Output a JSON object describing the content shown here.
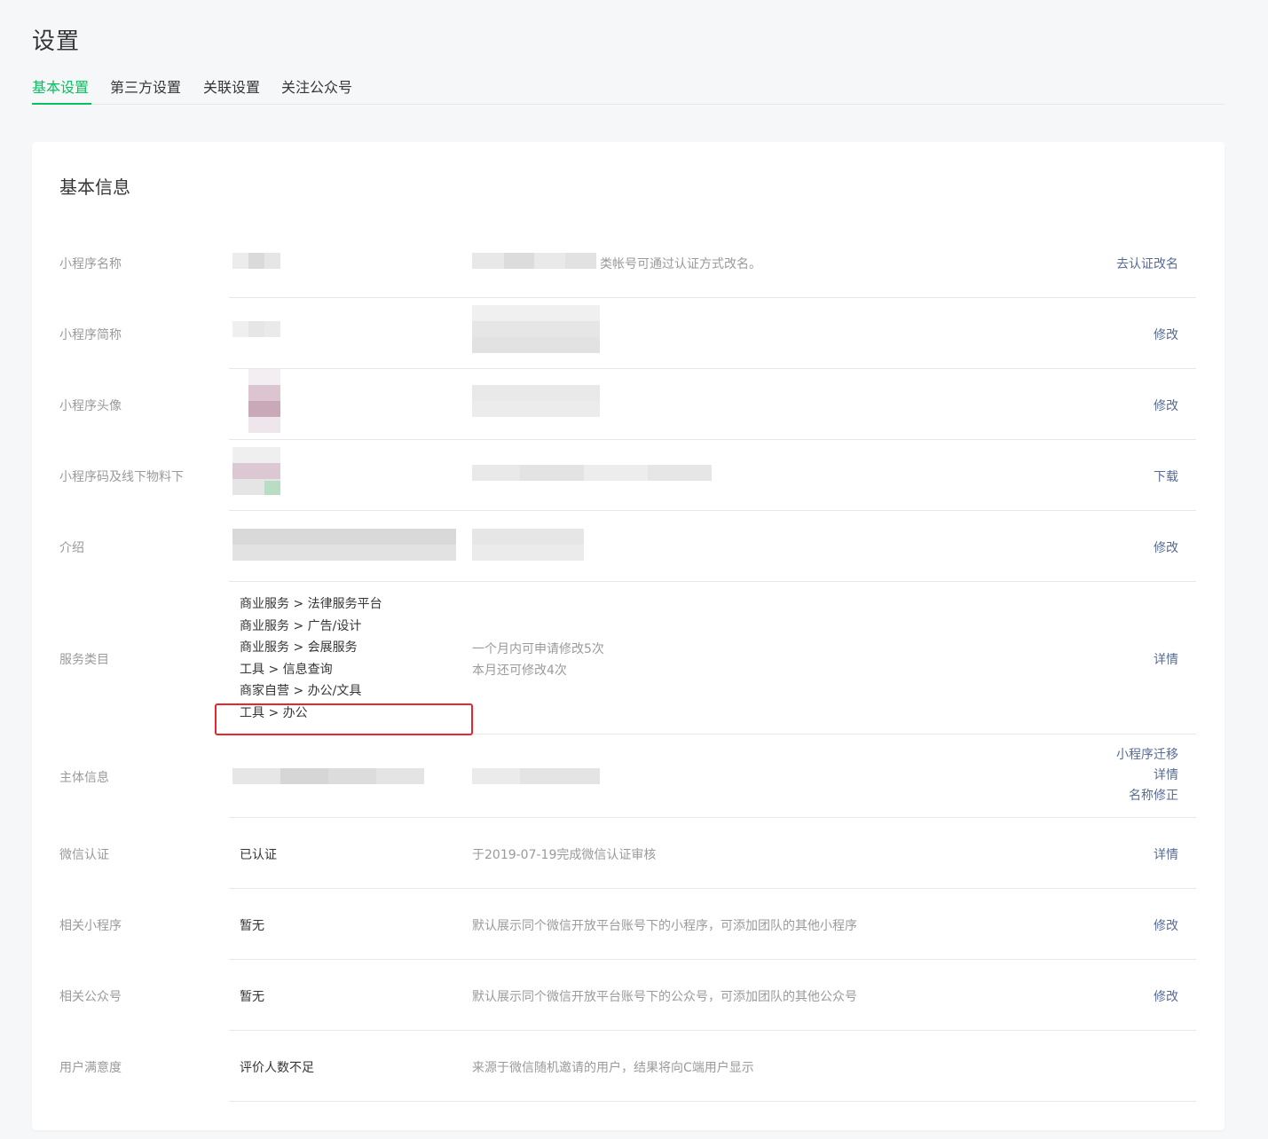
{
  "page": {
    "title": "设置"
  },
  "tabs": [
    {
      "label": "基本设置",
      "active": true
    },
    {
      "label": "第三方设置",
      "active": false
    },
    {
      "label": "关联设置",
      "active": false
    },
    {
      "label": "关注公众号",
      "active": false
    }
  ],
  "colors": {
    "accent": "#07c160",
    "link": "#576b95",
    "highlight": "#e8262d"
  },
  "section": {
    "title": "基本信息"
  },
  "rows": {
    "name": {
      "label": "小程序名称",
      "desc": "类帐号可通过认证方式改名。",
      "action": "去认证改名"
    },
    "short_name": {
      "label": "小程序简称",
      "action": "修改"
    },
    "avatar": {
      "label": "小程序头像",
      "action": "修改"
    },
    "qrcode": {
      "label": "小程序码及线下物料下",
      "action": "下载"
    },
    "intro": {
      "label": "介绍",
      "action": "修改"
    },
    "categories": {
      "label": "服务类目",
      "items": [
        "商业服务 > 法律服务平台",
        "商业服务 > 广告/设计",
        "商业服务 > 会展服务",
        "工具 > 信息查询",
        "商家自营 > 办公/文具",
        "工具 > 办公"
      ],
      "desc_line1": "一个月内可申请修改5次",
      "desc_line2": "本月还可修改4次",
      "action": "详情"
    },
    "subject": {
      "label": "主体信息",
      "actions": [
        "小程序迁移",
        "详情",
        "名称修正"
      ]
    },
    "wechat_cert": {
      "label": "微信认证",
      "value": "已认证",
      "desc": "于2019-07-19完成微信认证审核",
      "action": "详情"
    },
    "related_mini": {
      "label": "相关小程序",
      "value": "暂无",
      "desc": "默认展示同个微信开放平台账号下的小程序，可添加团队的其他小程序",
      "action": "修改"
    },
    "related_official": {
      "label": "相关公众号",
      "value": "暂无",
      "desc": "默认展示同个微信开放平台账号下的公众号，可添加团队的其他公众号",
      "action": "修改"
    },
    "satisfaction": {
      "label": "用户满意度",
      "value": "评价人数不足",
      "desc": "来源于微信随机邀请的用户，结果将向C端用户显示"
    }
  }
}
